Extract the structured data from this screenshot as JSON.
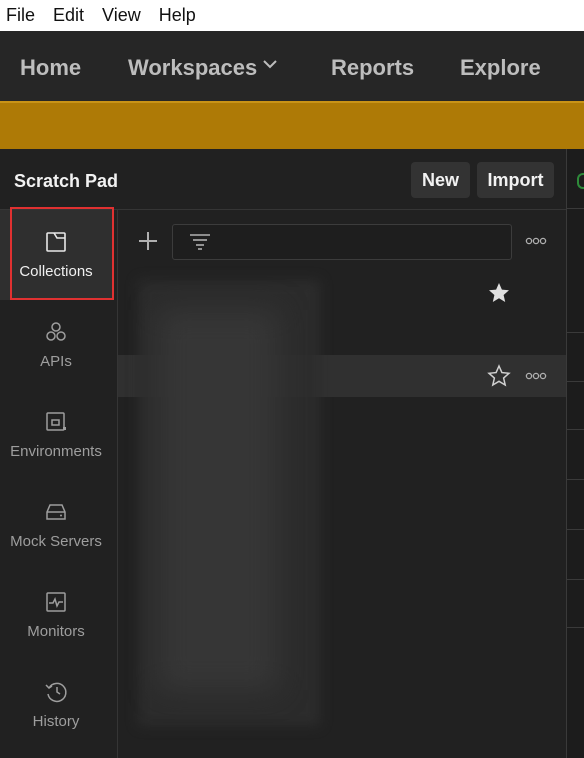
{
  "menu": [
    "File",
    "Edit",
    "View",
    "Help"
  ],
  "nav": {
    "home": "Home",
    "workspaces": "Workspaces",
    "reports": "Reports",
    "explore": "Explore"
  },
  "workspace": {
    "title": "Scratch Pad",
    "new_label": "New",
    "import_label": "Import"
  },
  "sidebar": {
    "items": [
      {
        "label": "Collections",
        "icon": "collection-icon",
        "active": true
      },
      {
        "label": "APIs",
        "icon": "apis-icon"
      },
      {
        "label": "Environments",
        "icon": "environments-icon"
      },
      {
        "label": "Mock Servers",
        "icon": "mock-server-icon"
      },
      {
        "label": "Monitors",
        "icon": "monitor-icon"
      },
      {
        "label": "History",
        "icon": "history-icon"
      }
    ]
  },
  "collections": {
    "filter_placeholder": "",
    "rows": [
      {
        "starred": true
      },
      {
        "starred": false,
        "hovered": true
      }
    ]
  },
  "colors": {
    "banner": "#ae7a06",
    "highlight": "#e03131",
    "background": "#212121"
  }
}
